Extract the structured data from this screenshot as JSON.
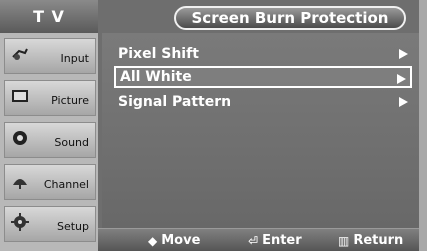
{
  "sidebar": {
    "header": "T V",
    "items": [
      {
        "label": "Input",
        "icon": "input-icon"
      },
      {
        "label": "Picture",
        "icon": "picture-icon"
      },
      {
        "label": "Sound",
        "icon": "sound-icon"
      },
      {
        "label": "Channel",
        "icon": "channel-icon"
      },
      {
        "label": "Setup",
        "icon": "setup-icon"
      }
    ]
  },
  "main": {
    "title": "Screen Burn Protection",
    "menu": [
      {
        "label": "Pixel Shift",
        "selected": false
      },
      {
        "label": "All White",
        "selected": true
      },
      {
        "label": "Signal Pattern",
        "selected": false
      }
    ]
  },
  "bottom": {
    "move_label": "Move",
    "enter_label": "Enter",
    "return_label": "Return",
    "move_glyph": "◆",
    "enter_glyph": "⏎",
    "return_glyph": "▥"
  }
}
